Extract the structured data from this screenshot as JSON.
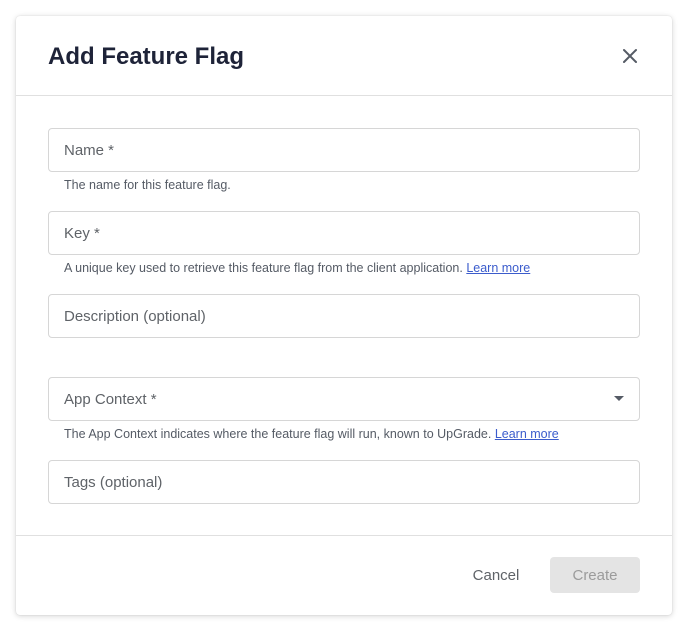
{
  "dialog": {
    "title": "Add Feature Flag",
    "close_icon": "close-icon"
  },
  "form": {
    "name": {
      "placeholder": "Name *",
      "value": "",
      "hint": "The name for this feature flag."
    },
    "key": {
      "placeholder": "Key *",
      "value": "",
      "hint": "A unique key used to retrieve this feature flag from the client application.",
      "hint_link": "Learn more"
    },
    "description": {
      "placeholder": "Description (optional)",
      "value": ""
    },
    "app_context": {
      "placeholder": "App Context *",
      "selected": "",
      "hint": "The App Context indicates where the feature flag will run, known to UpGrade.",
      "hint_link": "Learn more",
      "icon": "chevron-down-icon"
    },
    "tags": {
      "placeholder": "Tags (optional)",
      "value": ""
    }
  },
  "footer": {
    "cancel_label": "Cancel",
    "create_label": "Create"
  },
  "colors": {
    "title": "#1e2338",
    "link": "#3b5ccc",
    "disabled_button_bg": "#e4e4e4",
    "disabled_button_text": "#9b9b9b",
    "border": "#d6d6d6"
  }
}
